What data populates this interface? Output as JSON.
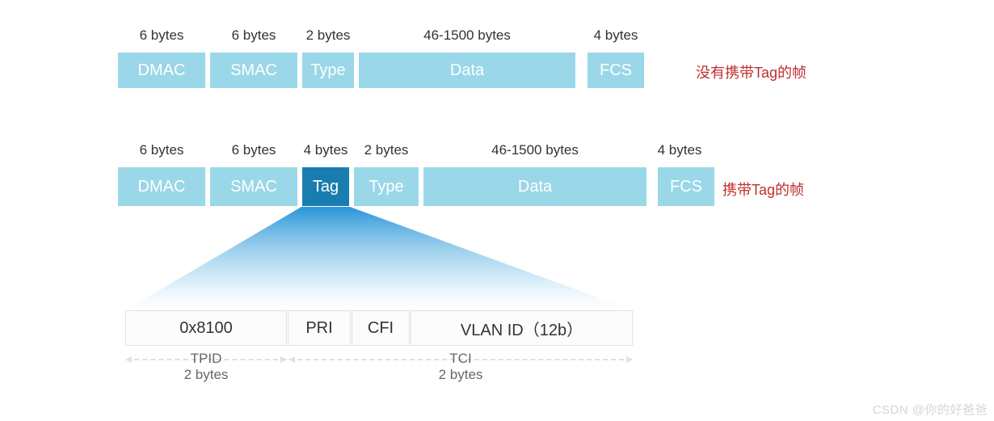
{
  "frame1": {
    "sizes": [
      "6 bytes",
      "6 bytes",
      "2 bytes",
      "46-1500 bytes",
      "4 bytes"
    ],
    "fields": [
      "DMAC",
      "SMAC",
      "Type",
      "Data",
      "FCS"
    ],
    "caption": "没有携带Tag的帧"
  },
  "frame2": {
    "sizes": [
      "6 bytes",
      "6 bytes",
      "4 bytes",
      "2 bytes",
      "46-1500 bytes",
      "4 bytes"
    ],
    "fields": [
      "DMAC",
      "SMAC",
      "Tag",
      "Type",
      "Data",
      "FCS"
    ],
    "caption": "携带Tag的帧"
  },
  "tag_detail": {
    "fields": [
      "0x8100",
      "PRI",
      "CFI",
      "VLAN ID（12b）"
    ],
    "tpid_label": "TPID",
    "tpid_size": "2 bytes",
    "tci_label": "TCI",
    "tci_size": "2 bytes"
  },
  "watermark": "CSDN @你的好爸爸"
}
